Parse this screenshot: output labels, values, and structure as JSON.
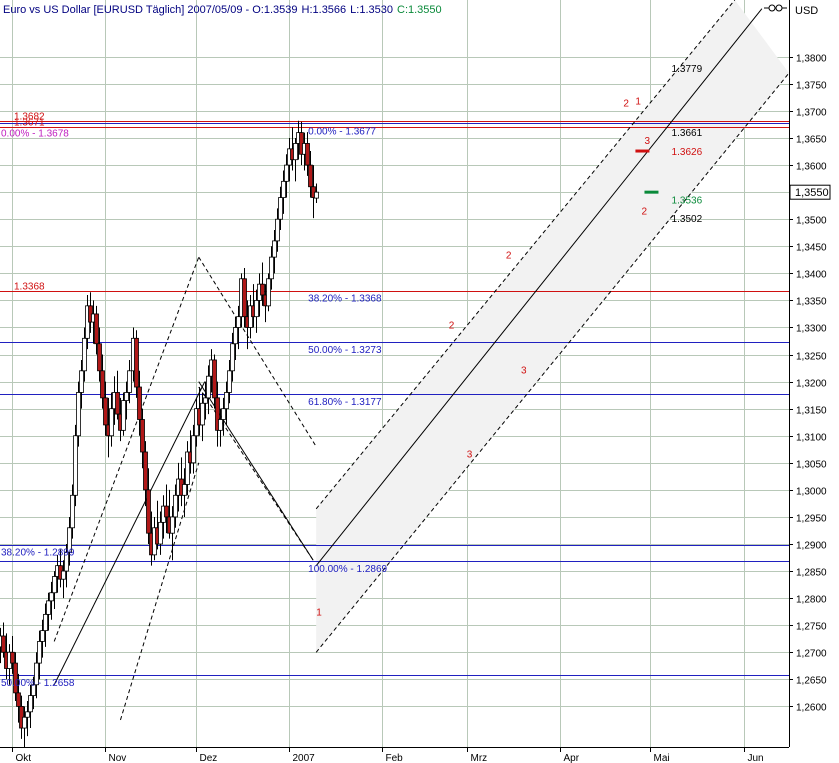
{
  "chart_data": {
    "type": "candlestick",
    "title": {
      "name": "Euro vs US Dollar [EURUSD  Täglich] 2007/05/09 - ",
      "open": "O:1.3539",
      "high": "H:1.3566",
      "low": "L:1.3530",
      "close": "C:1.3550"
    },
    "currency": "USD",
    "ylim": [
      1.2525,
      1.3905
    ],
    "y_ticks": [
      "1,3800",
      "1,3750",
      "1,3700",
      "1,3650",
      "1,3600",
      "1,3550",
      "1,3500",
      "1,3450",
      "1,3400",
      "1,3350",
      "1,3300",
      "1,3250",
      "1,3200",
      "1,3150",
      "1,3100",
      "1,3050",
      "1,3000",
      "1,2950",
      "1,2900",
      "1,2850",
      "1,2800",
      "1,2750",
      "1,2700",
      "1,2650",
      "1,2600"
    ],
    "y_tick_values": [
      1.38,
      1.375,
      1.37,
      1.365,
      1.36,
      1.355,
      1.35,
      1.345,
      1.34,
      1.335,
      1.33,
      1.325,
      1.32,
      1.315,
      1.31,
      1.305,
      1.3,
      1.295,
      1.29,
      1.285,
      1.28,
      1.275,
      1.27,
      1.265,
      1.26
    ],
    "current_price": "1,3550",
    "current_price_value": 1.355,
    "x_labels": [
      {
        "text": "Okt",
        "day": 0
      },
      {
        "text": "Nov",
        "day": 31
      },
      {
        "text": "Dez",
        "day": 61
      },
      {
        "text": "2007",
        "day": 92
      },
      {
        "text": "Feb",
        "day": 123
      },
      {
        "text": "Mrz",
        "day": 151
      },
      {
        "text": "Apr",
        "day": 182
      },
      {
        "text": "Mai",
        "day": 212
      },
      {
        "text": "Jun",
        "day": 243
      }
    ],
    "x_range": [
      -4,
      258
    ],
    "h_lines": [
      {
        "y": 1.3682,
        "color": "#d01010",
        "label": "1.3682"
      },
      {
        "y": 1.3677,
        "color": "#2020c0",
        "label": ""
      },
      {
        "y": 1.3671,
        "color": "#d01010",
        "label": "1.3671"
      },
      {
        "y": 1.3368,
        "color": "#d01010",
        "label": "1.3368"
      },
      {
        "y": 1.3273,
        "color": "#2020c0",
        "label": ""
      },
      {
        "y": 1.3177,
        "color": "#2020c0",
        "label": ""
      },
      {
        "y": 1.2899,
        "color": "#2020c0",
        "label": ""
      },
      {
        "y": 1.2869,
        "color": "#2020c0",
        "label": ""
      },
      {
        "y": 1.2658,
        "color": "#2020c0",
        "label": ""
      }
    ],
    "fib_levels": [
      {
        "text": "0.00% - 1.3677",
        "y": 1.3677,
        "day": 98,
        "color": "#2020c0"
      },
      {
        "text": "38.20% - 1.3368",
        "y": 1.3368,
        "day": 98,
        "color": "#2020c0"
      },
      {
        "text": "50.00% - 1.3273",
        "y": 1.3273,
        "day": 98,
        "color": "#2020c0"
      },
      {
        "text": "61.80% - 1.3177",
        "y": 1.3177,
        "day": 98,
        "color": "#2020c0"
      },
      {
        "text": "100.00% - 1.2869",
        "y": 1.2869,
        "day": 98,
        "color": "#2020c0"
      },
      {
        "text": "0.00% - 1.3678",
        "y": 1.3673,
        "day": -4,
        "color": "#c020c0"
      },
      {
        "text": "38.20% - 1.2899",
        "y": 1.2899,
        "day": -4,
        "color": "#2020c0"
      },
      {
        "text": "50.00% - 1.2658",
        "y": 1.2658,
        "day": -4,
        "color": "#2020c0"
      }
    ],
    "price_labels": [
      {
        "text": "1.3779",
        "y": 1.3779,
        "day": 219,
        "color": "#000000"
      },
      {
        "text": "1.3661",
        "y": 1.3661,
        "day": 219,
        "color": "#000000"
      },
      {
        "text": "1.3626",
        "y": 1.3626,
        "day": 219,
        "color": "#d01010"
      },
      {
        "text": "1.3536",
        "y": 1.3536,
        "day": 219,
        "color": "#0a8a3a"
      },
      {
        "text": "1.3502",
        "y": 1.3502,
        "day": 219,
        "color": "#000000"
      }
    ],
    "wave_labels": [
      {
        "text": "1",
        "day": 101,
        "y": 1.2768
      },
      {
        "text": "2",
        "day": 145,
        "y": 1.3298
      },
      {
        "text": "3",
        "day": 151,
        "y": 1.306
      },
      {
        "text": "2",
        "day": 164,
        "y": 1.3427
      },
      {
        "text": "3",
        "day": 169,
        "y": 1.3215
      },
      {
        "text": "2",
        "day": 203,
        "y": 1.3708
      },
      {
        "text": "1",
        "day": 207,
        "y": 1.3712
      },
      {
        "text": "3",
        "day": 210,
        "y": 1.3639
      },
      {
        "text": "2",
        "day": 209,
        "y": 1.3509
      }
    ],
    "trend_lines": [
      {
        "p1": [
          101,
          1.286
        ],
        "p2": [
          249,
          1.3889
        ],
        "dash": false
      },
      {
        "p1": [
          101,
          1.2965
        ],
        "p2": [
          240,
          1.3905
        ],
        "dash": true
      },
      {
        "p1": [
          101,
          1.27
        ],
        "p2": [
          258,
          1.377
        ],
        "dash": true
      },
      {
        "p1": [
          14,
          1.264
        ],
        "p2": [
          64,
          1.32
        ],
        "dash": false
      },
      {
        "p1": [
          14,
          1.272
        ],
        "p2": [
          62,
          1.343
        ],
        "dash": true
      },
      {
        "p1": [
          36,
          1.2575
        ],
        "p2": [
          62,
          1.305
        ],
        "dash": true
      },
      {
        "p1": [
          62,
          1.343
        ],
        "p2": [
          101,
          1.308
        ],
        "dash": true
      },
      {
        "p1": [
          62,
          1.32
        ],
        "p2": [
          100,
          1.287
        ],
        "dash": false
      },
      {
        "p1": [
          62,
          1.319
        ],
        "p2": [
          100,
          1.287
        ],
        "dash": true
      }
    ],
    "channel": [
      [
        101,
        1.2965
      ],
      [
        240,
        1.3905
      ],
      [
        258,
        1.377
      ],
      [
        101,
        1.27
      ]
    ],
    "highlight_bars": [
      {
        "day": 212,
        "y": 1.355,
        "color": "#0a8a3a",
        "dashed": false
      },
      {
        "day": 209,
        "y": 1.3626,
        "color": "#d01010",
        "dashed": false
      }
    ],
    "candles": [
      [
        1.271,
        1.2745,
        1.268,
        1.273
      ],
      [
        1.273,
        1.2755,
        1.269,
        1.27
      ],
      [
        1.27,
        1.2735,
        1.265,
        1.267
      ],
      [
        1.267,
        1.2715,
        1.264,
        1.27
      ],
      [
        1.27,
        1.273,
        1.266,
        1.268
      ],
      [
        1.268,
        1.27,
        1.261,
        1.2625
      ],
      [
        1.2625,
        1.266,
        1.257,
        1.26
      ],
      [
        1.26,
        1.262,
        1.254,
        1.256
      ],
      [
        1.256,
        1.26,
        1.2525,
        1.258
      ],
      [
        1.258,
        1.261,
        1.2545,
        1.259
      ],
      [
        1.259,
        1.264,
        1.256,
        1.262
      ],
      [
        1.262,
        1.2655,
        1.2595,
        1.264
      ],
      [
        1.264,
        1.27,
        1.2615,
        1.268
      ],
      [
        1.268,
        1.274,
        1.265,
        1.272
      ],
      [
        1.272,
        1.276,
        1.269,
        1.274
      ],
      [
        1.274,
        1.279,
        1.271,
        1.277
      ],
      [
        1.277,
        1.281,
        1.274,
        1.2795
      ],
      [
        1.2795,
        1.283,
        1.276,
        1.281
      ],
      [
        1.281,
        1.285,
        1.278,
        1.284
      ],
      [
        1.284,
        1.288,
        1.281,
        1.286
      ],
      [
        1.286,
        1.289,
        1.282,
        1.2835
      ],
      [
        1.2835,
        1.287,
        1.28,
        1.285
      ],
      [
        1.285,
        1.29,
        1.282,
        1.2885
      ],
      [
        1.2885,
        1.295,
        1.286,
        1.293
      ],
      [
        1.293,
        1.301,
        1.291,
        1.299
      ],
      [
        1.299,
        1.312,
        1.297,
        1.31
      ],
      [
        1.31,
        1.32,
        1.308,
        1.318
      ],
      [
        1.318,
        1.324,
        1.315,
        1.322
      ],
      [
        1.322,
        1.33,
        1.32,
        1.328
      ],
      [
        1.328,
        1.336,
        1.326,
        1.334
      ],
      [
        1.334,
        1.3365,
        1.329,
        1.331
      ],
      [
        1.331,
        1.335,
        1.327,
        1.3325
      ],
      [
        1.3325,
        1.334,
        1.325,
        1.327
      ],
      [
        1.327,
        1.33,
        1.32,
        1.322
      ],
      [
        1.322,
        1.325,
        1.315,
        1.317
      ],
      [
        1.317,
        1.32,
        1.31,
        1.312
      ],
      [
        1.312,
        1.317,
        1.306,
        1.31
      ],
      [
        1.31,
        1.318,
        1.308,
        1.315
      ],
      [
        1.315,
        1.321,
        1.312,
        1.318
      ],
      [
        1.318,
        1.322,
        1.313,
        1.314
      ],
      [
        1.314,
        1.317,
        1.309,
        1.311
      ],
      [
        1.311,
        1.318,
        1.31,
        1.3165
      ],
      [
        1.3165,
        1.32,
        1.313,
        1.318
      ],
      [
        1.318,
        1.324,
        1.316,
        1.322
      ],
      [
        1.322,
        1.33,
        1.32,
        1.328
      ],
      [
        1.328,
        1.3295,
        1.317,
        1.319
      ],
      [
        1.319,
        1.322,
        1.31,
        1.313
      ],
      [
        1.313,
        1.315,
        1.304,
        1.307
      ],
      [
        1.307,
        1.309,
        1.297,
        1.3
      ],
      [
        1.3,
        1.304,
        1.29,
        1.292
      ],
      [
        1.292,
        1.296,
        1.286,
        1.288
      ],
      [
        1.288,
        1.295,
        1.287,
        1.293
      ],
      [
        1.293,
        1.298,
        1.289,
        1.29
      ],
      [
        1.29,
        1.296,
        1.288,
        1.294
      ],
      [
        1.294,
        1.299,
        1.291,
        1.297
      ],
      [
        1.297,
        1.301,
        1.292,
        1.295
      ],
      [
        1.295,
        1.3,
        1.291,
        1.292
      ],
      [
        1.292,
        1.297,
        1.287,
        1.295
      ],
      [
        1.295,
        1.301,
        1.293,
        1.299
      ],
      [
        1.299,
        1.305,
        1.296,
        1.302
      ],
      [
        1.302,
        1.306,
        1.297,
        1.299
      ],
      [
        1.299,
        1.304,
        1.295,
        1.301
      ],
      [
        1.301,
        1.309,
        1.299,
        1.307
      ],
      [
        1.307,
        1.311,
        1.303,
        1.305
      ],
      [
        1.305,
        1.312,
        1.303,
        1.31
      ],
      [
        1.31,
        1.317,
        1.308,
        1.315
      ],
      [
        1.315,
        1.319,
        1.31,
        1.312
      ],
      [
        1.312,
        1.318,
        1.309,
        1.316
      ],
      [
        1.316,
        1.32,
        1.313,
        1.317
      ],
      [
        1.317,
        1.323,
        1.314,
        1.321
      ],
      [
        1.321,
        1.326,
        1.318,
        1.324
      ],
      [
        1.324,
        1.325,
        1.315,
        1.317
      ],
      [
        1.317,
        1.32,
        1.308,
        1.311
      ],
      [
        1.311,
        1.315,
        1.308,
        1.313
      ],
      [
        1.313,
        1.317,
        1.31,
        1.315
      ],
      [
        1.315,
        1.32,
        1.312,
        1.318
      ],
      [
        1.318,
        1.324,
        1.316,
        1.322
      ],
      [
        1.322,
        1.329,
        1.32,
        1.327
      ],
      [
        1.327,
        1.332,
        1.324,
        1.33
      ],
      [
        1.33,
        1.334,
        1.326,
        1.332
      ],
      [
        1.332,
        1.34,
        1.33,
        1.339
      ],
      [
        1.339,
        1.341,
        1.33,
        1.332
      ],
      [
        1.332,
        1.335,
        1.326,
        1.33
      ],
      [
        1.33,
        1.336,
        1.328,
        1.334
      ],
      [
        1.334,
        1.338,
        1.33,
        1.332
      ],
      [
        1.332,
        1.337,
        1.329,
        1.335
      ],
      [
        1.335,
        1.34,
        1.332,
        1.338
      ],
      [
        1.338,
        1.342,
        1.334,
        1.336
      ],
      [
        1.336,
        1.338,
        1.331,
        1.334
      ],
      [
        1.334,
        1.34,
        1.333,
        1.339
      ],
      [
        1.339,
        1.345,
        1.337,
        1.343
      ],
      [
        1.343,
        1.348,
        1.34,
        1.346
      ],
      [
        1.346,
        1.352,
        1.344,
        1.35
      ],
      [
        1.35,
        1.356,
        1.348,
        1.354
      ],
      [
        1.354,
        1.359,
        1.351,
        1.357
      ],
      [
        1.357,
        1.362,
        1.354,
        1.36
      ],
      [
        1.36,
        1.365,
        1.357,
        1.363
      ],
      [
        1.363,
        1.367,
        1.359,
        1.361
      ],
      [
        1.361,
        1.365,
        1.357,
        1.364
      ],
      [
        1.364,
        1.3682,
        1.361,
        1.366
      ],
      [
        1.366,
        1.368,
        1.36,
        1.362
      ],
      [
        1.362,
        1.366,
        1.359,
        1.364
      ],
      [
        1.364,
        1.3661,
        1.358,
        1.36
      ],
      [
        1.36,
        1.3626,
        1.354,
        1.356
      ],
      [
        1.356,
        1.36,
        1.3502,
        1.354
      ],
      [
        1.3539,
        1.3566,
        1.353,
        1.355
      ]
    ],
    "candle_days": [
      -4,
      -3,
      -2,
      -1,
      0,
      1,
      2,
      3,
      4,
      5,
      6,
      7,
      8,
      9,
      10,
      11,
      12,
      13,
      14,
      15,
      16,
      17,
      18,
      19,
      20,
      21,
      22,
      23,
      24,
      25,
      26,
      27,
      28,
      29,
      30,
      31,
      32,
      33,
      34,
      35,
      36,
      37,
      38,
      39,
      40,
      41,
      42,
      43,
      44,
      45,
      46,
      47,
      48,
      49,
      50,
      51,
      52,
      53,
      54,
      55,
      56,
      57,
      58,
      59,
      60,
      61,
      62,
      63,
      64,
      65,
      66,
      67,
      68,
      69,
      70,
      71,
      72,
      73,
      74,
      75,
      76,
      77,
      78,
      79,
      80,
      81,
      82,
      83,
      84,
      85,
      86,
      87,
      88,
      89,
      90,
      91,
      92,
      93,
      94,
      95,
      96,
      97,
      98,
      99,
      100,
      101
    ],
    "colors": {
      "up": "#ffffff",
      "down": "#b01818",
      "wick": "#000000",
      "grid": "#b8c8b8",
      "channel": "#f2f2f2",
      "wave": "#d01010",
      "current_price": "#000000",
      "green": "#0a8a3a"
    }
  }
}
